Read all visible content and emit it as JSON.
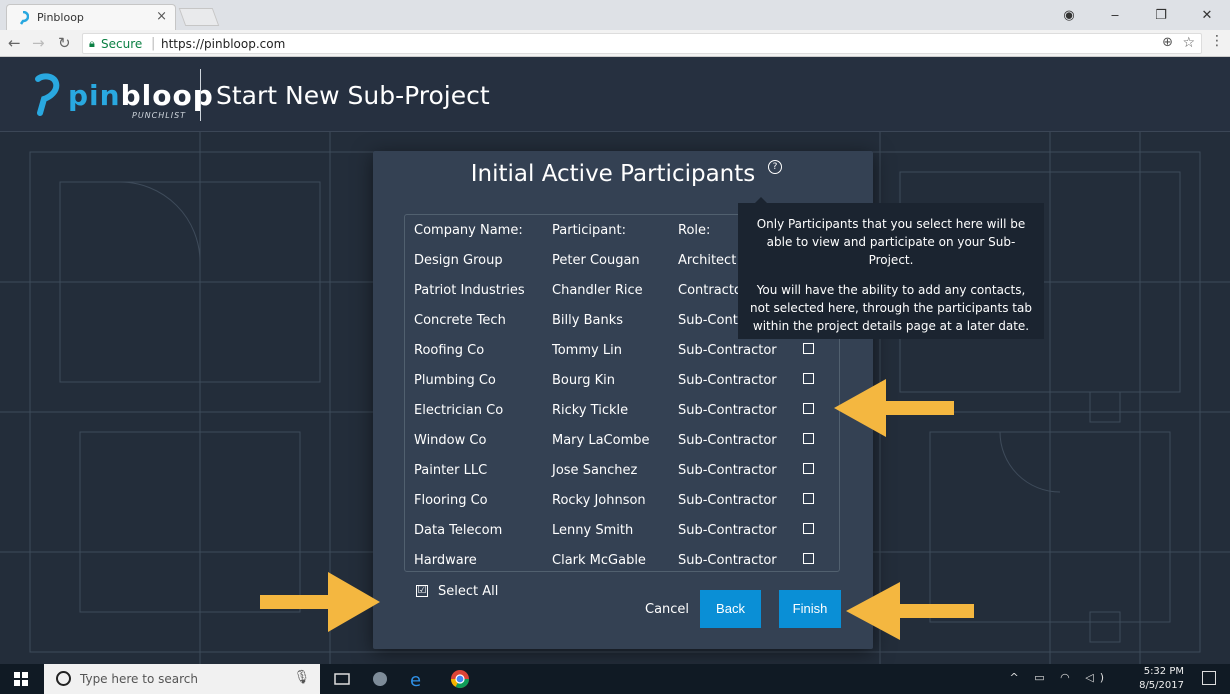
{
  "browser": {
    "tab_title": "Pinbloop",
    "tab_close": "×",
    "secure_label": "Secure",
    "url": "https://pinbloop.com",
    "window_controls": [
      "‒",
      "❐",
      "✕"
    ]
  },
  "header": {
    "logo_pin": "pin",
    "logo_bloop": "bloop",
    "logo_sub": "PUNCHLIST",
    "page_title": "Start New Sub-Project"
  },
  "modal": {
    "title": "Initial Active Participants",
    "help": "?",
    "columns": [
      "Company Name:",
      "Participant:",
      "Role:"
    ],
    "rows": [
      {
        "company": "Design Group",
        "participant": "Peter Cougan",
        "role": "Architect"
      },
      {
        "company": "Patriot Industries",
        "participant": "Chandler Rice",
        "role": "Contractor"
      },
      {
        "company": "Concrete Tech",
        "participant": "Billy Banks",
        "role": "Sub-Contr"
      },
      {
        "company": "Roofing Co",
        "participant": "Tommy Lin",
        "role": "Sub-Contractor"
      },
      {
        "company": "Plumbing Co",
        "participant": "Bourg Kin",
        "role": "Sub-Contractor"
      },
      {
        "company": "Electrician Co",
        "participant": "Ricky Tickle",
        "role": "Sub-Contractor"
      },
      {
        "company": "Window Co",
        "participant": "Mary LaCombe",
        "role": "Sub-Contractor"
      },
      {
        "company": "Painter LLC",
        "participant": "Jose Sanchez",
        "role": "Sub-Contractor"
      },
      {
        "company": "Flooring Co",
        "participant": "Rocky Johnson",
        "role": "Sub-Contractor"
      },
      {
        "company": "Data Telecom",
        "participant": "Lenny Smith",
        "role": "Sub-Contractor"
      },
      {
        "company": "Hardware",
        "participant": "Clark McGable",
        "role": "Sub-Contractor"
      }
    ],
    "select_all_label": "Select All",
    "select_all_mark": "☑",
    "cancel_label": "Cancel",
    "back_label": "Back",
    "finish_label": "Finish"
  },
  "tooltip": {
    "line1": "Only Participants that you select here will be able to view and participate on your Sub-Project.",
    "line2": "You will have the ability to add any contacts, not selected here, through the participants tab within the project details page at a later date."
  },
  "taskbar": {
    "search_placeholder": "Type here to search",
    "time": "5:32 PM",
    "date": "8/5/2017"
  },
  "colors": {
    "accent": "#0a8fd6",
    "arrow": "#f4b740",
    "modal_bg": "#344153"
  }
}
